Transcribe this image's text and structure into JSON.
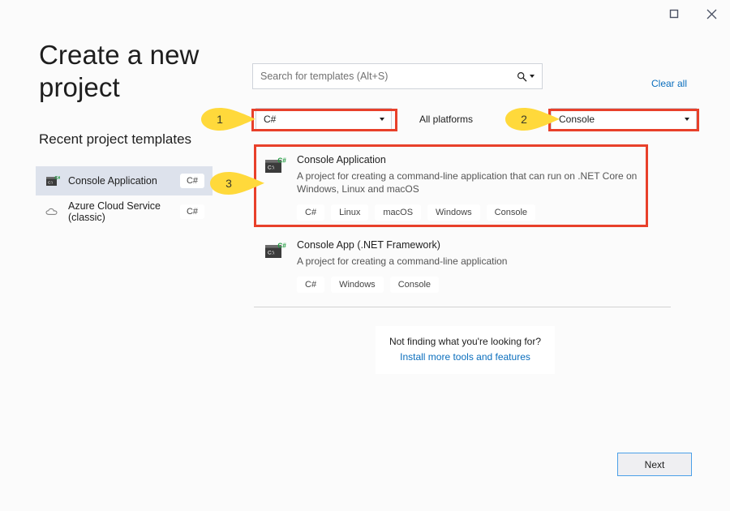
{
  "window": {
    "maximize_icon": "maximize-icon",
    "close_icon": "close-icon"
  },
  "header": {
    "title": "Create a new project",
    "recent_heading": "Recent project templates"
  },
  "search": {
    "placeholder": "Search for templates (Alt+S)",
    "value": "",
    "icon": "search-icon",
    "dropdown_icon": "chevron-down-icon"
  },
  "clear_all_label": "Clear all",
  "filters": {
    "language": {
      "value": "C#",
      "icon": "chevron-down-icon"
    },
    "platform": {
      "value": "All platforms",
      "icon": "chevron-down-icon"
    },
    "project_type": {
      "value": "Console",
      "icon": "chevron-down-icon"
    }
  },
  "recent_templates": [
    {
      "label": "Console Application",
      "sub": "",
      "badge": "C#",
      "icon": "console-app-icon",
      "selected": true
    },
    {
      "label": "Azure Cloud Service",
      "sub": "(classic)",
      "badge": "C#",
      "icon": "cloud-icon",
      "selected": false
    }
  ],
  "templates": [
    {
      "name": "Console Application",
      "description": "A project for creating a command-line application that can run on .NET Core on Windows, Linux and macOS",
      "icon": "console-app-icon",
      "tags": [
        "C#",
        "Linux",
        "macOS",
        "Windows",
        "Console"
      ]
    },
    {
      "name": "Console App (.NET Framework)",
      "description": "A project for creating a command-line application",
      "icon": "console-app-icon",
      "tags": [
        "C#",
        "Windows",
        "Console"
      ]
    }
  ],
  "not_finding": {
    "question": "Not finding what you're looking for?",
    "link": "Install more tools and features"
  },
  "next_button_label": "Next",
  "annotations": {
    "callouts": [
      {
        "number": "1",
        "target": "language-filter-dropdown"
      },
      {
        "number": "2",
        "target": "project-type-filter-dropdown"
      },
      {
        "number": "3",
        "target": "console-application-template"
      }
    ],
    "highlight_color": "#e8402a",
    "callout_color": "#ffd93b"
  }
}
